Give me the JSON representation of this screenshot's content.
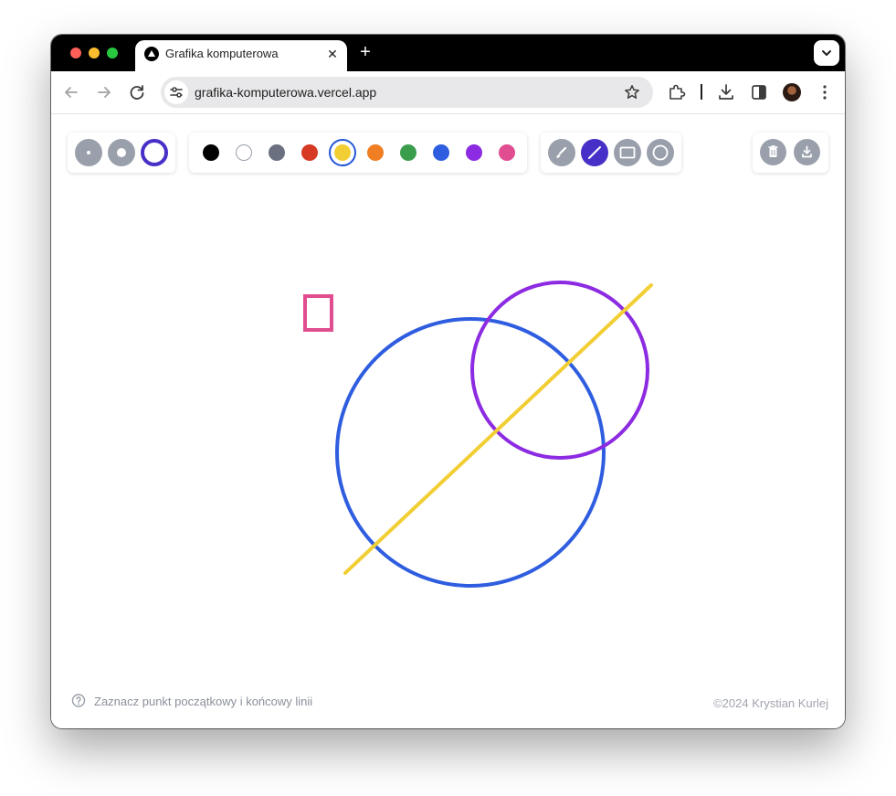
{
  "browser": {
    "tab_title": "Grafika komputerowa",
    "tab_close": "✕",
    "new_tab": "+",
    "url": "grafika-komputerowa.vercel.app"
  },
  "app": {
    "sizes": [
      "small",
      "medium",
      "large"
    ],
    "selected_size": "large",
    "colors": [
      {
        "name": "black",
        "hex": "#000000"
      },
      {
        "name": "white",
        "hex": "#ffffff"
      },
      {
        "name": "gray",
        "hex": "#6b7080"
      },
      {
        "name": "red",
        "hex": "#d63a24"
      },
      {
        "name": "yellow",
        "hex": "#f2ce35"
      },
      {
        "name": "orange",
        "hex": "#f07e22"
      },
      {
        "name": "green",
        "hex": "#3a9d4c"
      },
      {
        "name": "blue",
        "hex": "#2f5de0"
      },
      {
        "name": "purple",
        "hex": "#8c2be2"
      },
      {
        "name": "pink",
        "hex": "#e04d90"
      }
    ],
    "selected_color": "yellow",
    "tools": [
      "brush",
      "line",
      "rectangle",
      "circle"
    ],
    "selected_tool": "line",
    "actions": [
      "delete",
      "download"
    ],
    "accent": "#4630c8",
    "inactive": "#9aa0ab",
    "hint": "Zaznacz punkt początkowy i końcowy linii",
    "copyright": "©2024 Krystian Kurlej"
  },
  "drawing": {
    "shapes": [
      {
        "type": "rectangle",
        "color": "#e04d90"
      },
      {
        "type": "circle",
        "color": "#2f5de0"
      },
      {
        "type": "circle",
        "color": "#8c2be2"
      },
      {
        "type": "line",
        "color": "#f2ce35"
      }
    ]
  }
}
